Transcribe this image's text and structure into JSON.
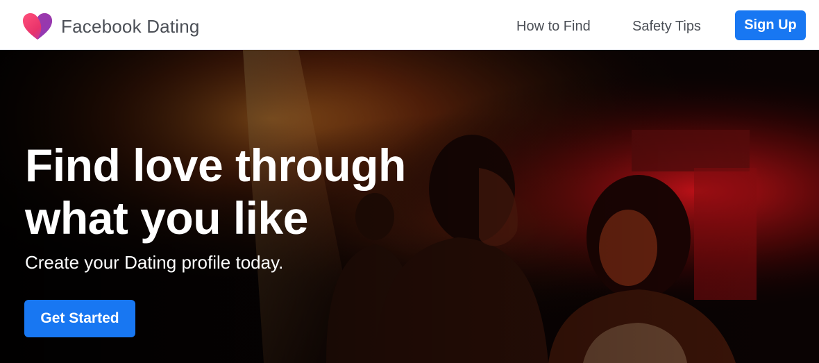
{
  "header": {
    "brand": "Facebook Dating",
    "logo_icon": "heart-icon",
    "nav": [
      {
        "label": "How to Find"
      },
      {
        "label": "Safety Tips"
      }
    ],
    "signup_label": "Sign Up"
  },
  "hero": {
    "title_line1": "Find love through",
    "title_line2": "what you like",
    "subtitle": "Create your Dating profile today.",
    "cta_label": "Get Started",
    "background_image": "couple dancing in red-lit club"
  },
  "colors": {
    "accent": "#1877f2",
    "heart_pink": "#f23b6e",
    "heart_purple": "#8a3ab9",
    "header_text": "#4b4f56"
  }
}
